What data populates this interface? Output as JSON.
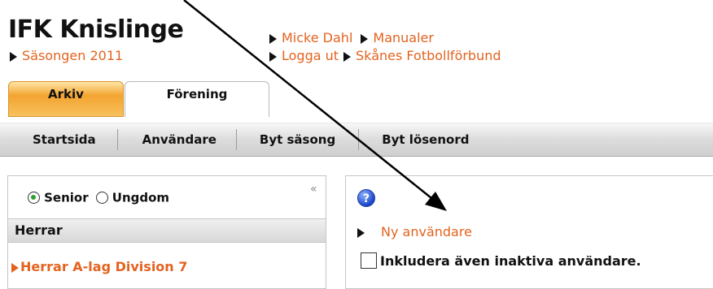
{
  "header": {
    "site_title": "IFK Knislinge",
    "season_link": "Säsongen 2011",
    "user_link": "Micke Dahl",
    "manuals_link": "Manualer",
    "logout_link": "Logga ut",
    "federation_link": "Skånes Fotbollförbund"
  },
  "tabs": [
    {
      "label": "Arkiv",
      "active": true
    },
    {
      "label": "Förening",
      "active": false
    }
  ],
  "nav": {
    "items": [
      "Startsida",
      "Användare",
      "Byt säsong",
      "Byt lösenord"
    ]
  },
  "left_panel": {
    "radio_senior": "Senior",
    "radio_ungdom": "Ungdom",
    "selected": "Senior",
    "collapse_icon": "«",
    "group_header": "Herrar",
    "team_link": "Herrar A-lag Division 7"
  },
  "right_panel": {
    "help_icon": "?",
    "new_user_link": "Ny användare",
    "include_inactive_label": "Inkludera även inaktiva användare."
  },
  "colors": {
    "link": "#e3631f",
    "tab_active": "#f3a431",
    "help_icon": "#1a45c9"
  }
}
